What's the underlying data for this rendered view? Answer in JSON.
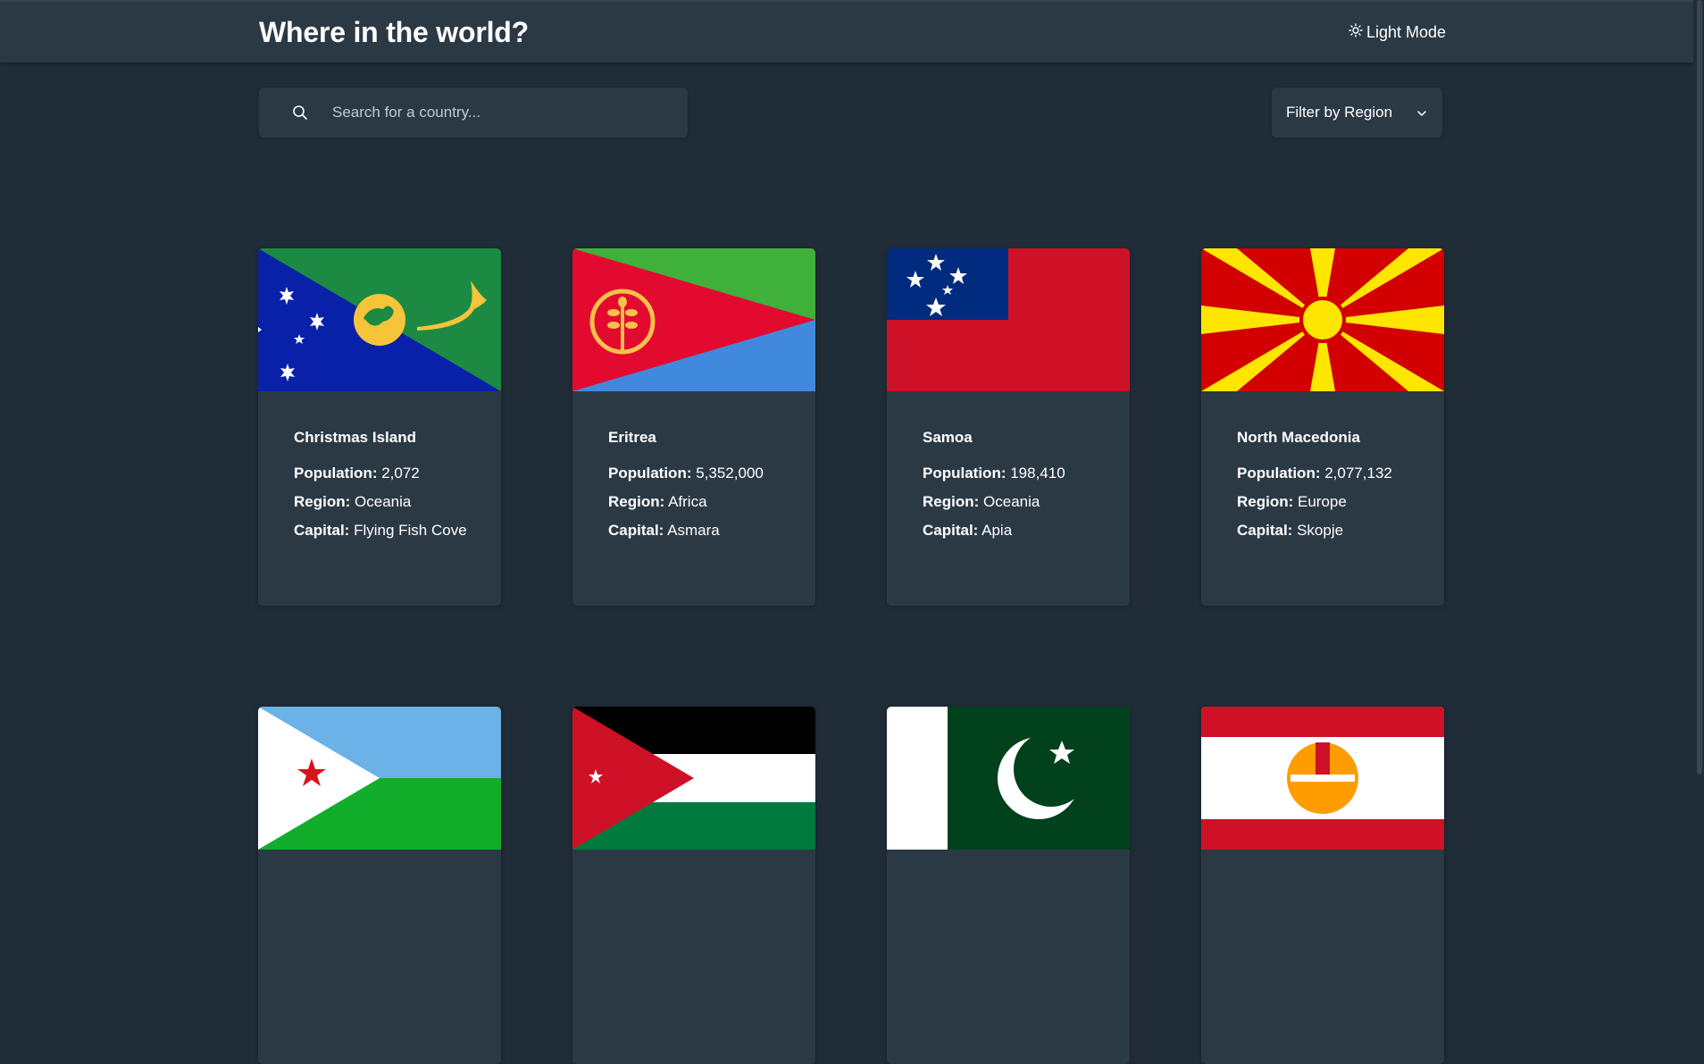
{
  "header": {
    "title": "Where in the world?",
    "mode_label": "Light Mode",
    "mode_icon": "sun-icon"
  },
  "search": {
    "placeholder": "Search for a country...",
    "value": "",
    "icon": "search-icon"
  },
  "filter": {
    "label": "Filter by Region",
    "icon": "chevron-down-icon"
  },
  "labels": {
    "population": "Population:",
    "region": "Region:",
    "capital": "Capital:"
  },
  "countries": [
    {
      "name": "Christmas Island",
      "population": "2,072",
      "region": "Oceania",
      "capital": "Flying Fish Cove",
      "flag": "christmas-island-flag"
    },
    {
      "name": "Eritrea",
      "population": "5,352,000",
      "region": "Africa",
      "capital": "Asmara",
      "flag": "eritrea-flag"
    },
    {
      "name": "Samoa",
      "population": "198,410",
      "region": "Oceania",
      "capital": "Apia",
      "flag": "samoa-flag"
    },
    {
      "name": "North Macedonia",
      "population": "2,077,132",
      "region": "Europe",
      "capital": "Skopje",
      "flag": "north-macedonia-flag"
    }
  ],
  "partial_flags": [
    "djibouti-flag",
    "jordan-flag",
    "pakistan-flag",
    "french-polynesia-flag"
  ],
  "colors": {
    "background": "#202c37",
    "element": "#2b3945",
    "text": "#ffffff"
  }
}
